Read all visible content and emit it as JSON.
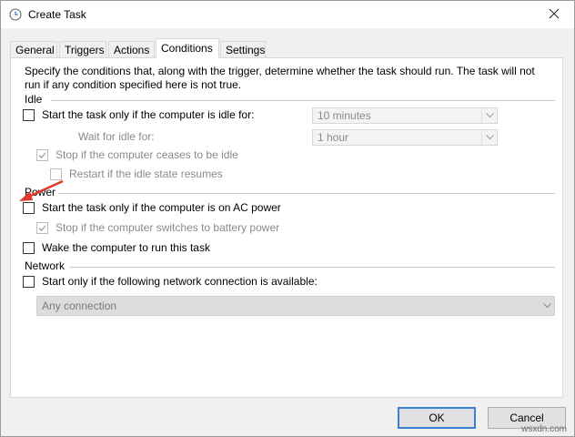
{
  "window": {
    "title": "Create Task",
    "icons": {
      "app": "clock-icon",
      "close": "close-icon"
    }
  },
  "tabs": [
    {
      "label": "General",
      "active": false
    },
    {
      "label": "Triggers",
      "active": false
    },
    {
      "label": "Actions",
      "active": false
    },
    {
      "label": "Conditions",
      "active": true
    },
    {
      "label": "Settings",
      "active": false
    }
  ],
  "conditions": {
    "intro": "Specify the conditions that, along with the trigger, determine whether the task should run.  The task will not run  if any condition specified here is not true.",
    "idle": {
      "group_label": "Idle",
      "start_if_idle_label": "Start the task only if the computer is idle for:",
      "start_if_idle_checked": false,
      "idle_for_value": "10 minutes",
      "wait_label": "Wait for idle for:",
      "wait_value": "1 hour",
      "stop_if_not_idle_label": "Stop if the computer ceases to be idle",
      "stop_if_not_idle_checked": true,
      "restart_label": "Restart if the idle state resumes",
      "restart_checked": false
    },
    "power": {
      "group_label": "Power",
      "ac_power_label": "Start the task only if the computer is on AC power",
      "ac_power_checked": false,
      "battery_label": "Stop if the computer switches to battery power",
      "battery_checked": true,
      "wake_label": "Wake the computer to run this task",
      "wake_checked": false
    },
    "network": {
      "group_label": "Network",
      "start_if_network_label": "Start only if the following network connection is available:",
      "start_if_network_checked": false,
      "connection_value": "Any connection"
    }
  },
  "buttons": {
    "ok": "OK",
    "cancel": "Cancel"
  },
  "annotation": {
    "arrow_color": "#e0392b"
  },
  "watermark": "wsxdn.com",
  "colors": {
    "accent": "#3c7fd7"
  }
}
